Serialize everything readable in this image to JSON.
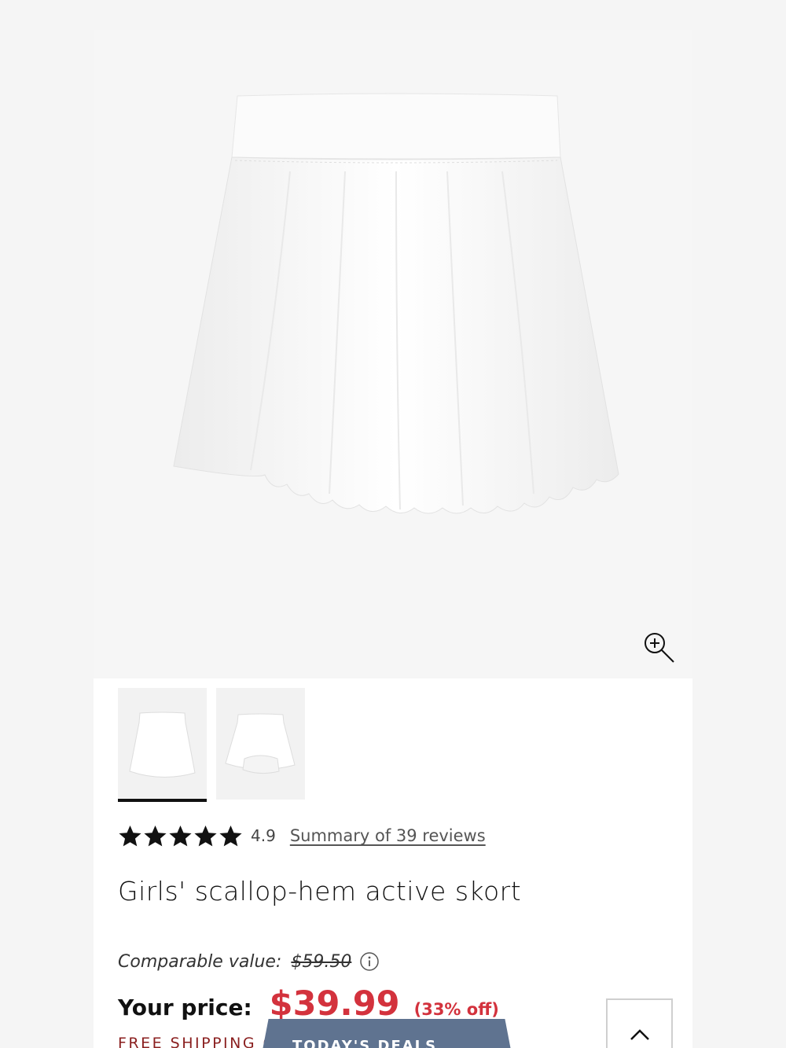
{
  "product": {
    "rating_value": "4.9",
    "reviews_link": "Summary of 39 reviews",
    "title": "Girls' scallop-hem active skort",
    "comparable_label": "Comparable value:",
    "comparable_price": "$59.50",
    "price_label": "Your price:",
    "price": "$39.99",
    "discount": "(33% off)",
    "shipping_note": "FREE SHIPPING C",
    "star_count": 5
  },
  "buttons": {
    "deals_label": "TODAY'S DEALS"
  },
  "icons": {
    "zoom": "zoom-in-icon",
    "info": "info-icon",
    "scroll_top": "chevron-up-icon",
    "star": "star-icon"
  },
  "colors": {
    "price_red": "#d3323d",
    "deals_bg": "#5f7390",
    "shipping_text": "#8a1f1f"
  }
}
